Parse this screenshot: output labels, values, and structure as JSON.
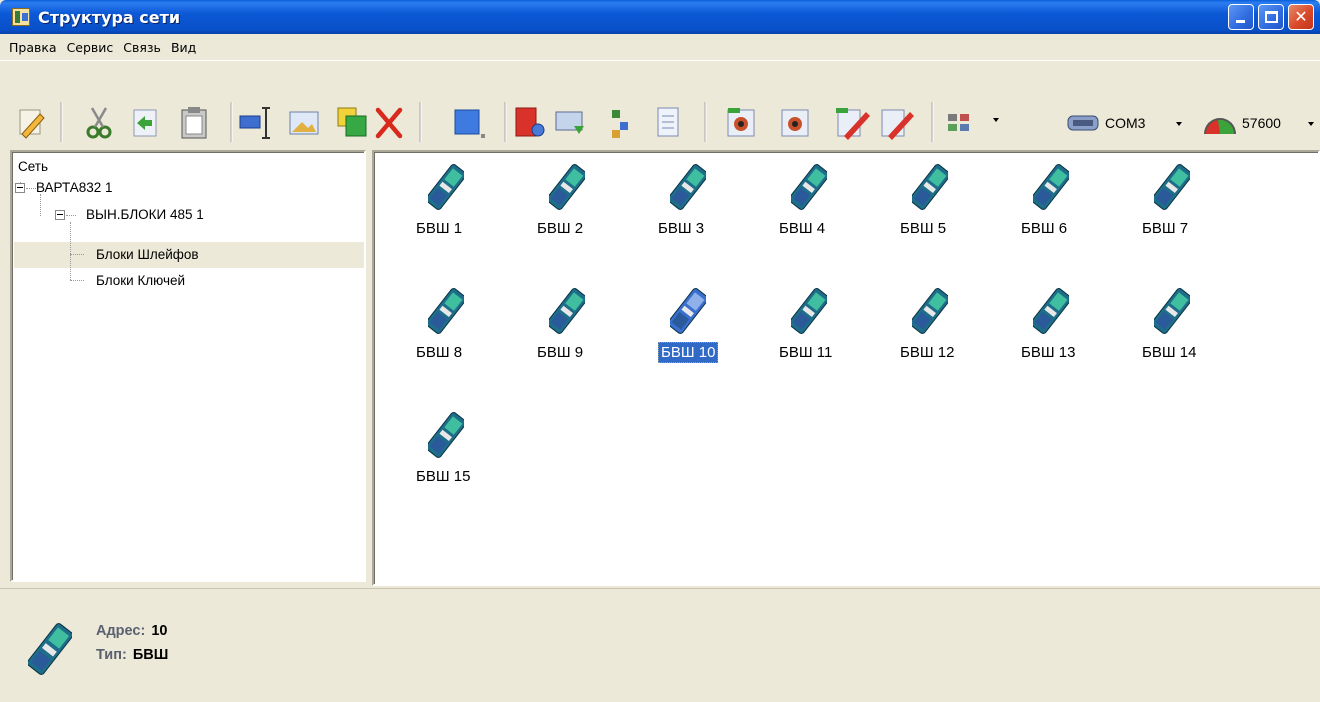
{
  "window": {
    "title": "Структура сети"
  },
  "menu": [
    "Правка",
    "Сервис",
    "Связь",
    "Вид"
  ],
  "toolbar": {
    "icons": [
      "edit-icon",
      "cut-icon",
      "paste-into-icon",
      "clipboard-icon",
      "rename-icon",
      "image-icon",
      "select-color-icon",
      "delete-icon",
      "rectangle-icon",
      "device-config-icon",
      "read-icon",
      "tree-icon",
      "document-icon",
      "view-icon",
      "view-alt-icon",
      "write-icon",
      "write-alt-icon",
      "layout-grid-icon"
    ],
    "port": "COM3",
    "speed": "57600"
  },
  "tree": {
    "root": "Сеть",
    "items": [
      {
        "label": "ВАРТА832 1"
      },
      {
        "label": "ВЫН.БЛОКИ 485 1"
      },
      {
        "label": "Блоки Шлейфов"
      },
      {
        "label": "Блоки Ключей"
      }
    ]
  },
  "devices": [
    {
      "label": "БВШ 1"
    },
    {
      "label": "БВШ 2"
    },
    {
      "label": "БВШ 3"
    },
    {
      "label": "БВШ 4"
    },
    {
      "label": "БВШ 5"
    },
    {
      "label": "БВШ 6"
    },
    {
      "label": "БВШ 7"
    },
    {
      "label": "БВШ 8"
    },
    {
      "label": "БВШ 9"
    },
    {
      "label": "БВШ 10",
      "selected": true
    },
    {
      "label": "БВШ 11"
    },
    {
      "label": "БВШ 12"
    },
    {
      "label": "БВШ 13"
    },
    {
      "label": "БВШ 14"
    },
    {
      "label": "БВШ 15"
    }
  ],
  "status": {
    "address_label": "Адрес:",
    "address_value": "10",
    "type_label": "Тип:",
    "type_value": "БВШ"
  },
  "colors": {
    "titlebar": "#0C58D6",
    "selection": "#3169C6",
    "panel_bg": "#ECE9D8"
  }
}
